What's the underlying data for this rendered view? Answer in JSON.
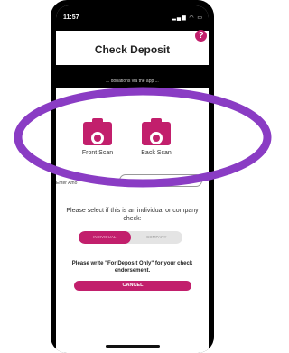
{
  "status_bar": {
    "time": "11:57",
    "icons": "▂▄▆ ◠ ▭"
  },
  "header": {
    "title": "Check Deposit",
    "help_symbol": "?"
  },
  "instruction": "... donations via the app ...",
  "scans": {
    "front_label": "Front Scan",
    "back_label": "Back Scan"
  },
  "amount": {
    "label": "Enter Amo",
    "value": ""
  },
  "check_type": {
    "question": "Please select if this is an individual or company check:",
    "options": [
      "INDIVIDUAL",
      "COMPANY"
    ],
    "selected": "INDIVIDUAL"
  },
  "note": "Please write \"For Deposit Only\" for your check endorsement.",
  "cancel_label": "CANCEL",
  "colors": {
    "accent": "#c21f6c",
    "highlight_ring": "#8a3cc4"
  }
}
